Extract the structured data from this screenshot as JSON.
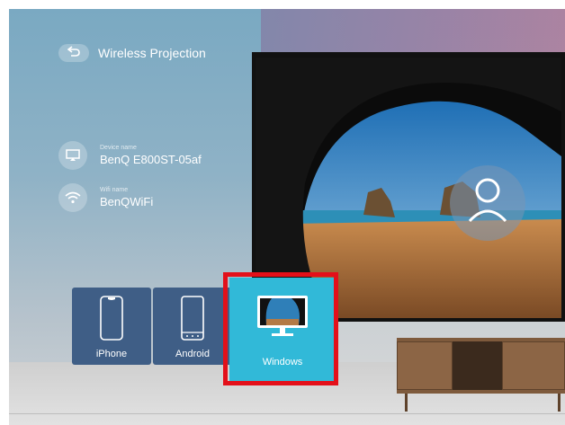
{
  "header": {
    "title": "Wireless Projection",
    "back_icon": "back-arrow-icon"
  },
  "device": {
    "label": "Device name",
    "value": "BenQ E800ST-05af",
    "icon": "cast-icon"
  },
  "wifi": {
    "label": "Wifi name",
    "value": "BenQWiFi",
    "icon": "wifi-icon"
  },
  "tiles": [
    {
      "label": "iPhone",
      "icon": "iphone-icon"
    },
    {
      "label": "Android",
      "icon": "android-phone-icon"
    },
    {
      "label": "Windows",
      "icon": "windows-monitor-icon",
      "selected": true
    }
  ],
  "colors": {
    "tile": "#3f5e86",
    "selected_tile": "#31b9d8",
    "highlight": "#e3101a"
  }
}
